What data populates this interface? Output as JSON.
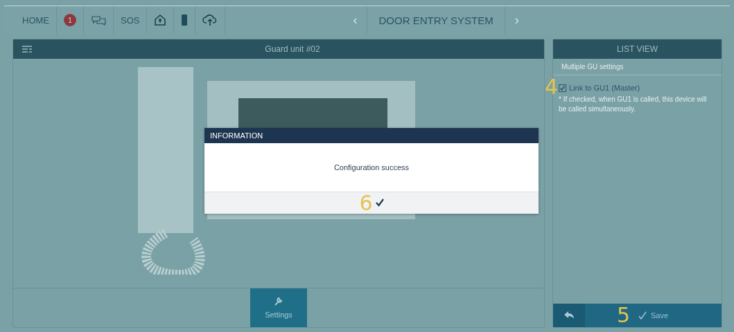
{
  "top_bar": {
    "home": "HOME",
    "badge": "1",
    "sos": "SOS",
    "prev": "‹",
    "title": "DOOR ENTRY SYSTEM",
    "next": "›"
  },
  "main_panel": {
    "title": "Guard unit #02",
    "settings_button": "Settings"
  },
  "list_view": {
    "title": "LIST VIEW",
    "section": "Multiple GU settings",
    "option": {
      "label": "Link to GU1 (Master)",
      "checked": true,
      "note": "* If checked, when GU1 is called, this device will be called simultaneously."
    },
    "save_button": "Save"
  },
  "dialog": {
    "title": "INFORMATION",
    "message": "Configuration success"
  },
  "annotations": [
    "4",
    "5",
    "6"
  ]
}
